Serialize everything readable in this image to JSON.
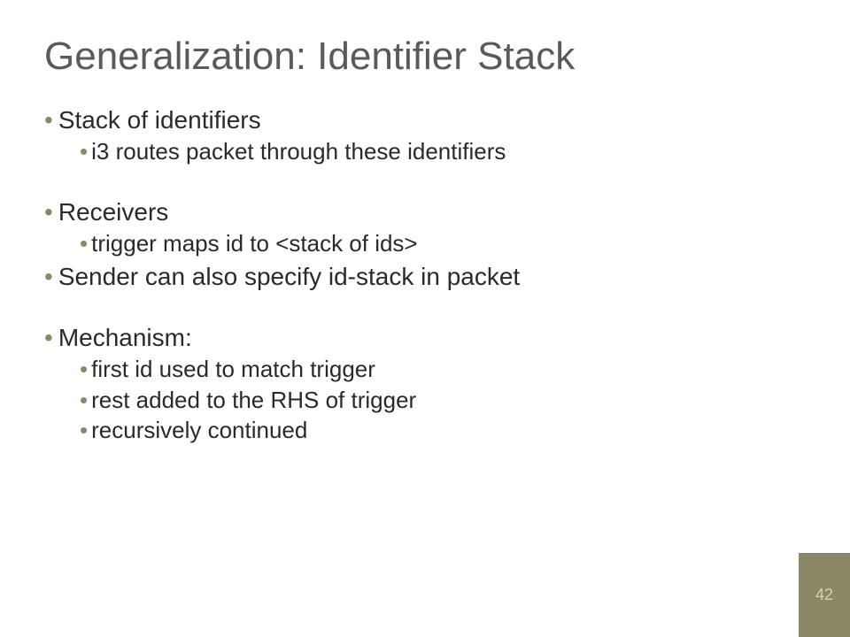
{
  "title": "Generalization: Identifier Stack",
  "bullets": {
    "b1": "Stack of identifiers",
    "b1a": "i3 routes packet through these identifiers",
    "b2": "Receivers",
    "b2a": "trigger maps id to <stack of ids>",
    "b3": "Sender can also specify id-stack in packet",
    "b4": "Mechanism:",
    "b4a": "first id used to match trigger",
    "b4b": "rest added to the RHS of trigger",
    "b4c": "recursively continued"
  },
  "page_number": "42"
}
